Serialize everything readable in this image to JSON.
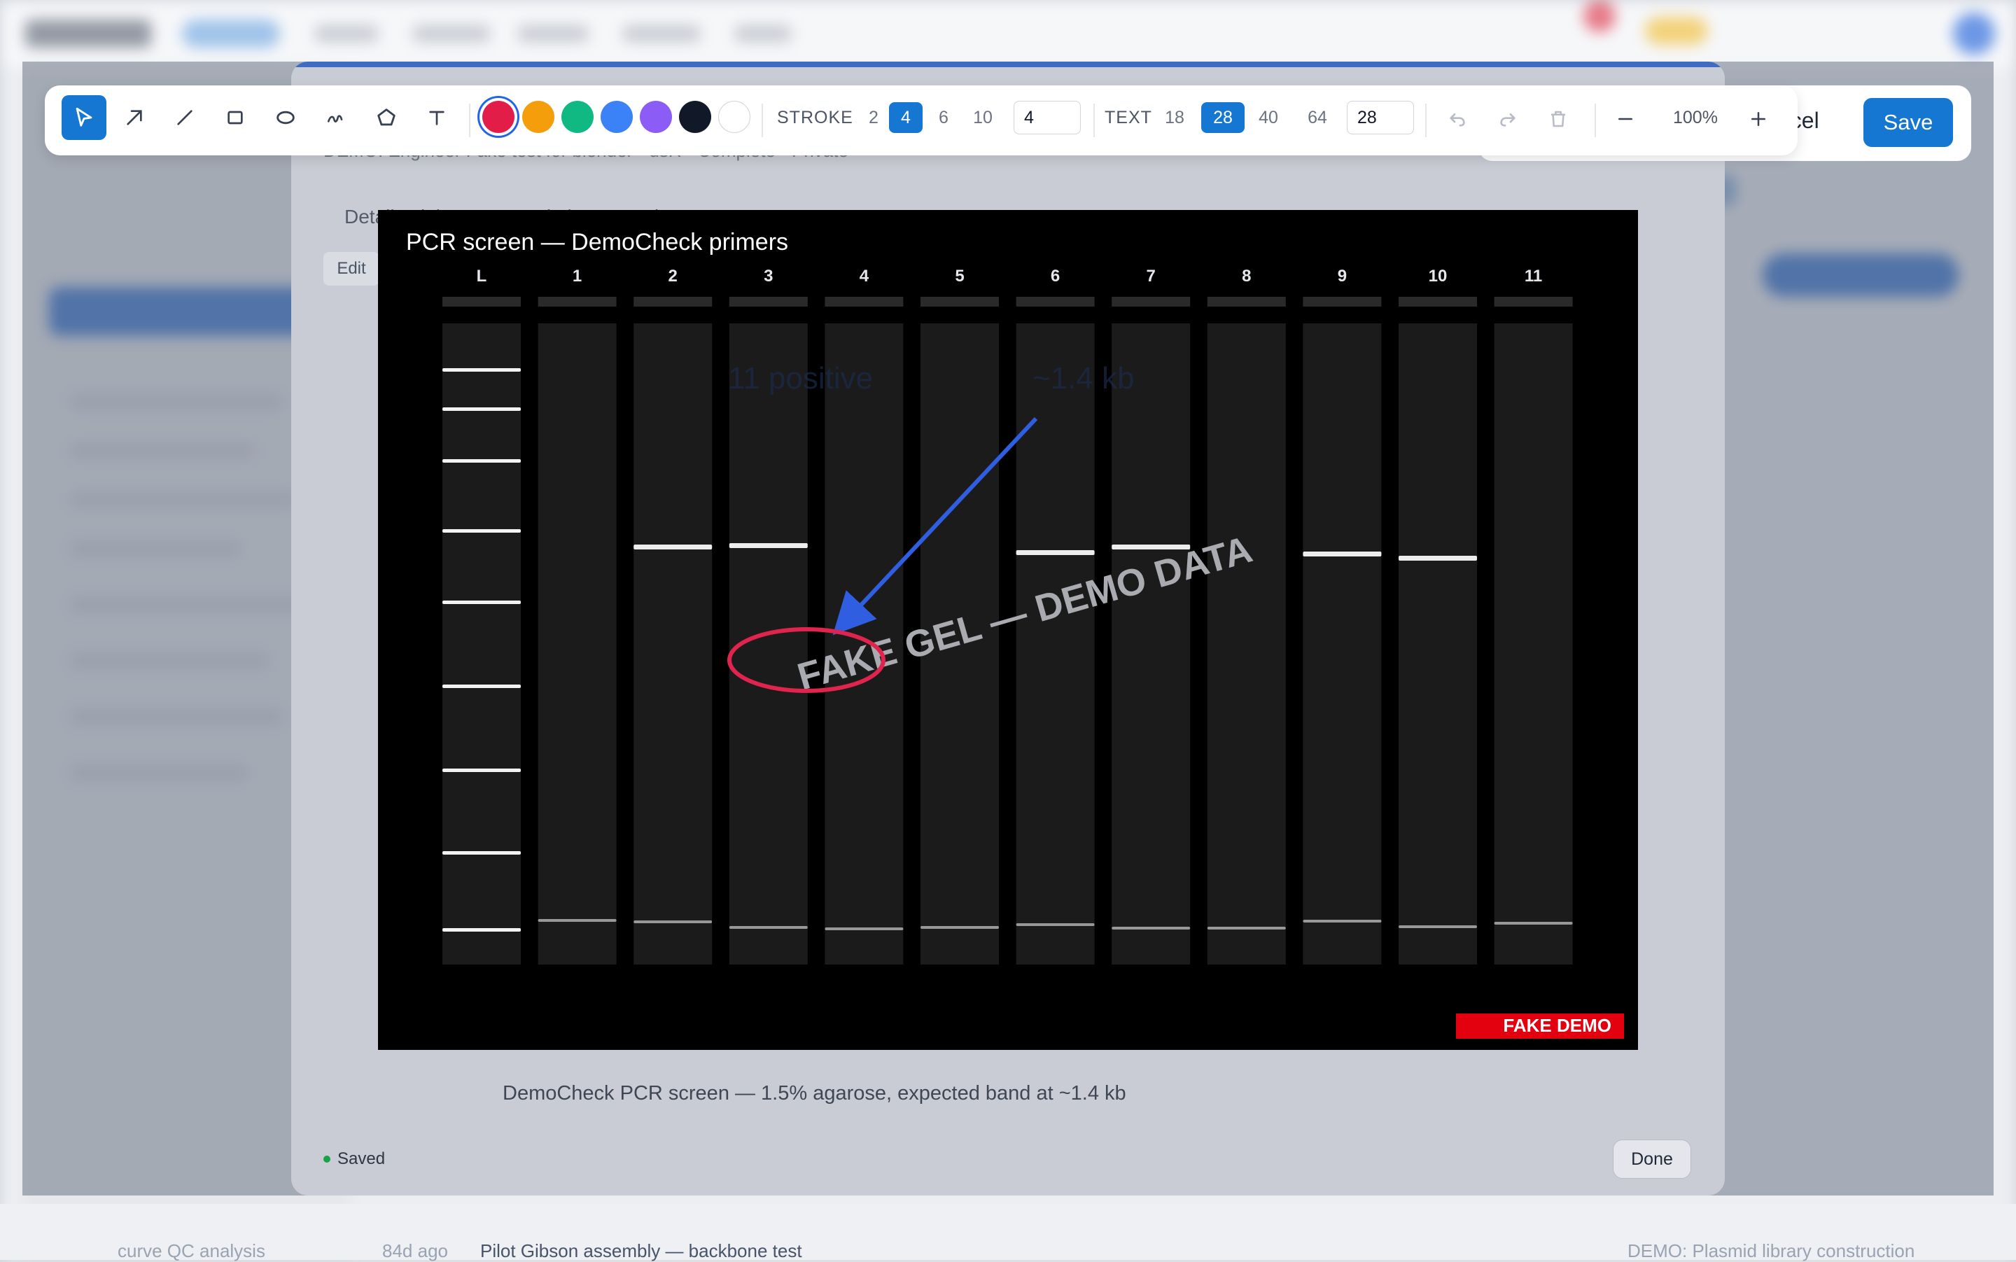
{
  "background": {
    "footer_row": {
      "time": "84d ago",
      "title": "Pilot Gibson assembly — backbone test",
      "project": "DEMO: Plasmid library construction",
      "left_item": "curve QC analysis"
    }
  },
  "modal": {
    "subtitle": "DEMO: Engineer Fake test for blender · dsR · Complete · Private",
    "tabs": "Details   Links   Notes   Variations   Results",
    "edit_label": "Edit",
    "caption": "DemoCheck PCR screen — 1.5% agarose, expected band at ~1.4 kb",
    "status": "Saved",
    "done_label": "Done"
  },
  "gel": {
    "title": "PCR screen — DemoCheck primers",
    "lane_labels": [
      "L",
      "1",
      "2",
      "3",
      "4",
      "5",
      "6",
      "7",
      "8",
      "9",
      "10",
      "11"
    ],
    "watermark": "FAKE GEL — DEMO DATA",
    "badge": "FAKE DEMO",
    "faint_annotation_1": "11 positive",
    "faint_annotation_2": "~1.4 kb"
  },
  "toolbar": {
    "tools": [
      {
        "name": "select-tool",
        "icon": "cursor-icon",
        "active": true
      },
      {
        "name": "arrow-tool",
        "icon": "arrow-icon"
      },
      {
        "name": "line-tool",
        "icon": "line-icon"
      },
      {
        "name": "rectangle-tool",
        "icon": "rectangle-icon"
      },
      {
        "name": "ellipse-tool",
        "icon": "ellipse-icon"
      },
      {
        "name": "freehand-tool",
        "icon": "freehand-icon"
      },
      {
        "name": "polygon-tool",
        "icon": "polygon-icon"
      },
      {
        "name": "text-tool",
        "icon": "text-icon"
      }
    ],
    "colors": [
      "#e11d48",
      "#f59e0b",
      "#10b981",
      "#3b82f6",
      "#8b5cf6",
      "#111827",
      "#ffffff"
    ],
    "selected_color": "#e11d48",
    "stroke_label": "STROKE",
    "stroke_sizes": [
      "2",
      "4",
      "6",
      "10"
    ],
    "stroke_selected": "4",
    "stroke_value": "4",
    "text_label": "TEXT",
    "text_sizes": [
      "18",
      "28",
      "40",
      "64"
    ],
    "text_selected": "28",
    "text_value": "28",
    "zoom": "100%"
  },
  "actions": {
    "cancel_label": "ncel",
    "save_label": "Save"
  },
  "annotation_colors": {
    "arrow": "#2f5fe0",
    "ellipse": "#e0244d"
  }
}
